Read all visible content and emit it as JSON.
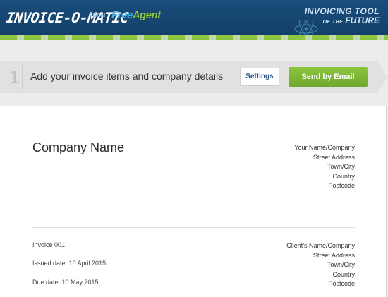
{
  "header": {
    "logo": "INVOICE-O-MATIC",
    "from_label": "FROM",
    "brand_part1": "Free",
    "brand_part2": "Agent",
    "tagline_line1": "INVOICING TOOL",
    "tagline_small": "OF THE",
    "tagline_line2": "FUTURE",
    "decor_icon": "atom-icon"
  },
  "step": {
    "number": "1",
    "title": "Add your invoice items and company details",
    "settings_label": "Settings",
    "send_label": "Send by Email"
  },
  "invoice": {
    "company_name": "Company Name",
    "sender": [
      "Your Name/Company",
      "Street Address",
      "Town/City",
      "Country",
      "Postcode"
    ],
    "number": "Invoice 001",
    "issued": "Issued date: 10 April 2015",
    "due": "Due date: 10 May 2015",
    "client": [
      "Client's Name/Company",
      "Street Address",
      "Town/City",
      "Country",
      "Postcode"
    ]
  },
  "colors": {
    "header_bg": "#13406a",
    "accent_green": "#8cc63f",
    "brand_blue": "#49b0e8"
  }
}
